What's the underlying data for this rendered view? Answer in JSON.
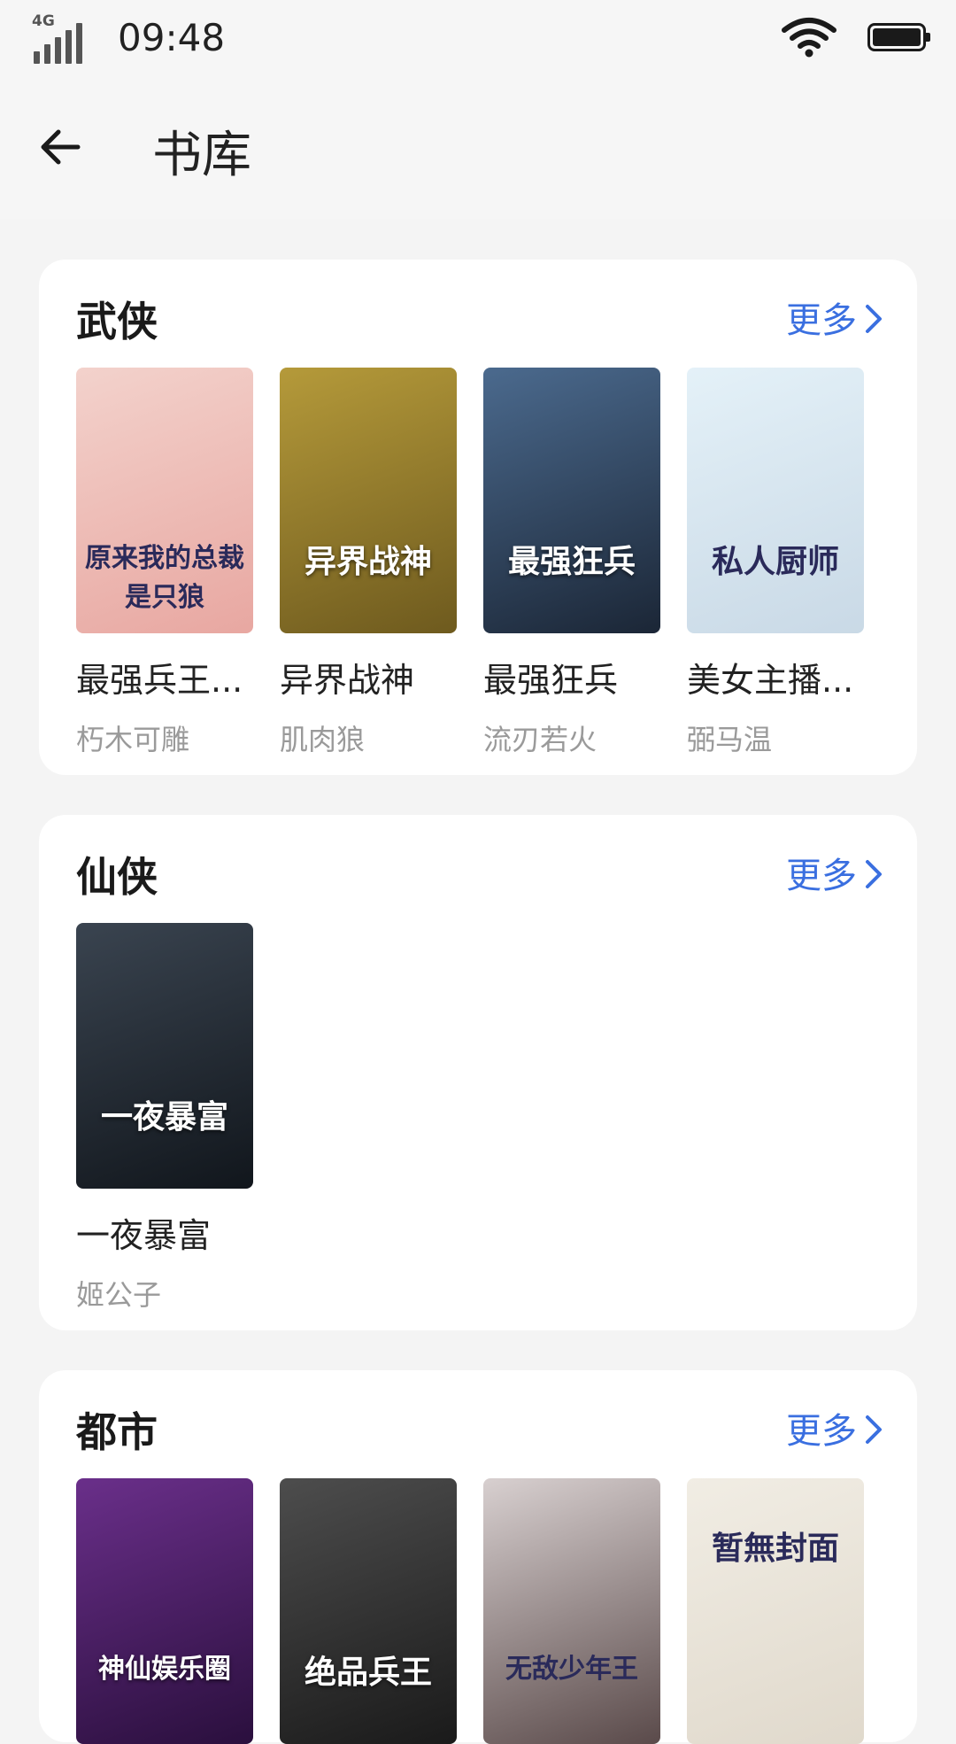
{
  "status": {
    "time": "09:48",
    "network": "4G"
  },
  "header": {
    "title": "书库",
    "back_icon": "arrow-left-icon"
  },
  "sections": [
    {
      "category": "武侠",
      "more_label": "更多",
      "books": [
        {
          "title": "最强兵王...",
          "author": "朽木可雕",
          "cover_text": "原来我的总裁是只狼",
          "cover_colors": [
            "#f3d2cc",
            "#e8a7a1"
          ]
        },
        {
          "title": "异界战神",
          "author": "肌肉狼",
          "cover_text": "异界战神",
          "cover_colors": [
            "#b59a3a",
            "#6e5a1e"
          ]
        },
        {
          "title": "最强狂兵",
          "author": "流刃若火",
          "cover_text": "最强狂兵",
          "cover_colors": [
            "#4b6a8e",
            "#1b2636"
          ]
        },
        {
          "title": "美女主播...",
          "author": "弼马温",
          "cover_text": "私人厨师",
          "cover_colors": [
            "#e4f1f8",
            "#c9d9e6"
          ]
        }
      ]
    },
    {
      "category": "仙侠",
      "more_label": "更多",
      "books": [
        {
          "title": "一夜暴富",
          "author": "姬公子",
          "cover_text": "一夜暴富",
          "cover_colors": [
            "#3a4450",
            "#11161c"
          ]
        }
      ]
    },
    {
      "category": "都市",
      "more_label": "更多",
      "books": [
        {
          "title": "",
          "author": "",
          "cover_text": "神仙娱乐圈",
          "cover_colors": [
            "#6a2f8a",
            "#2a0f3d"
          ]
        },
        {
          "title": "",
          "author": "",
          "cover_text": "绝品兵王",
          "cover_colors": [
            "#4d4d4d",
            "#1a1a1a"
          ]
        },
        {
          "title": "",
          "author": "",
          "cover_text": "无敌少年王",
          "cover_colors": [
            "#d8d0d0",
            "#5a4a4a"
          ]
        },
        {
          "title": "",
          "author": "",
          "cover_text": "暂無封面",
          "cover_colors": [
            "#f1ede4",
            "#e0d9cc"
          ]
        }
      ]
    }
  ]
}
